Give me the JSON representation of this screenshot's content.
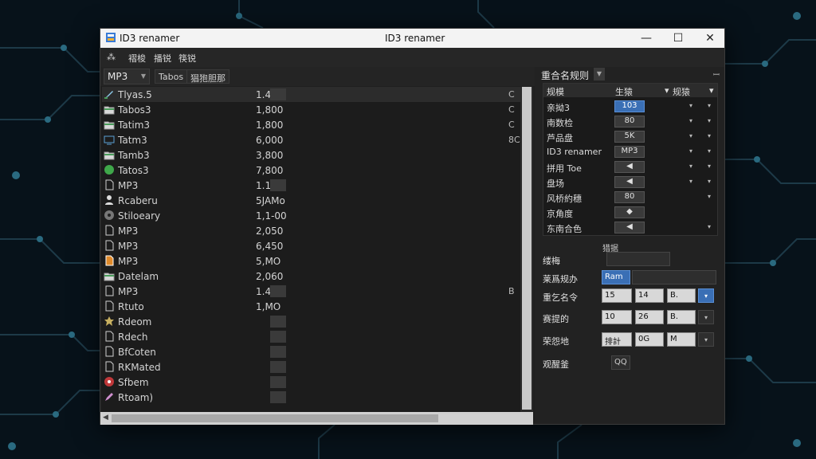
{
  "window": {
    "title_left": "ID3 renamer",
    "title_center": "ID3 renamer",
    "controls": {
      "minimize": "—",
      "maximize": "☐",
      "close": "✕"
    }
  },
  "menu": {
    "icon_glyph": "⁂",
    "items": [
      "褶梭",
      "播锐",
      "筷锐"
    ]
  },
  "toolbar": {
    "format_value": "MP3",
    "tab1": "Tabos",
    "tab2": "猖狍胆那"
  },
  "files": [
    {
      "name": "Tlyas.5",
      "size": "1.4",
      "extra": "C",
      "icon": "pen-icon",
      "selected": true
    },
    {
      "name": "Tabos3",
      "size": "1,800",
      "extra": "C",
      "icon": "folder-icon"
    },
    {
      "name": "Tatim3",
      "size": "1,800",
      "extra": "C",
      "icon": "folder-icon"
    },
    {
      "name": "Tatm3",
      "size": "6,000",
      "extra": "8C",
      "icon": "monitor-icon"
    },
    {
      "name": "Tamb3",
      "size": "3,800",
      "extra": "",
      "icon": "folder-icon"
    },
    {
      "name": "Tatos3",
      "size": "7,800",
      "extra": "",
      "icon": "green-circle-icon"
    },
    {
      "name": "MP3",
      "size": "1.1",
      "extra": "",
      "icon": "file-icon"
    },
    {
      "name": "Rcaberu",
      "size": "5JAMo",
      "extra": "",
      "icon": "person-icon"
    },
    {
      "name": "Stiloeary",
      "size": "1,1-00",
      "extra": "",
      "icon": "gear-icon"
    },
    {
      "name": "MP3",
      "size": "2,050",
      "extra": "",
      "icon": "file-icon"
    },
    {
      "name": "MP3",
      "size": "6,450",
      "extra": "",
      "icon": "file-icon"
    },
    {
      "name": "MP3",
      "size": "5,MO",
      "extra": "",
      "icon": "orange-file-icon"
    },
    {
      "name": "Datelam",
      "size": "2,060",
      "extra": "",
      "icon": "folder-icon"
    },
    {
      "name": "MP3",
      "size": "1.4",
      "extra": "B",
      "icon": "file-icon"
    },
    {
      "name": "Rtuto",
      "size": "1,MO",
      "extra": "",
      "icon": "file-icon"
    },
    {
      "name": "Rdeom",
      "size": "",
      "extra": "",
      "icon": "star-icon"
    },
    {
      "name": "Rdech",
      "size": "",
      "extra": "",
      "icon": "file-icon"
    },
    {
      "name": "BfCoten",
      "size": "",
      "extra": "",
      "icon": "file-icon"
    },
    {
      "name": "RKMated",
      "size": "",
      "extra": "",
      "icon": "file-icon"
    },
    {
      "name": "Sfbem",
      "size": "",
      "extra": "",
      "icon": "red-disc-icon"
    },
    {
      "name": "Rtoam)",
      "size": "",
      "extra": "",
      "icon": "pencil-icon"
    }
  ],
  "panel": {
    "header": "重合名规则",
    "pin": "ꟷ",
    "tag_headers": [
      "规模",
      "生猿",
      "规猿"
    ],
    "tags": [
      {
        "label": "亲拗3",
        "value": "103",
        "blue": true,
        "c1": "▾",
        "c2": "▾"
      },
      {
        "label": "南数检",
        "value": "80",
        "c1": "▾",
        "c2": "▾"
      },
      {
        "label": "芦品盘",
        "value": "5K",
        "c1": "▾",
        "c2": "▾"
      },
      {
        "label": "ID3 renamer",
        "value": "MP3",
        "c1": "▾",
        "c2": "▾"
      },
      {
        "label": "拼用 Toe",
        "value": "◀",
        "c1": "▾",
        "c2": "▾"
      },
      {
        "label": "盘场",
        "value": "◀",
        "c1": "▾",
        "c2": "▾"
      },
      {
        "label": "风桥約穗",
        "value": "80",
        "c1": "",
        "c2": "▾"
      },
      {
        "label": "京角度",
        "value": "◆",
        "c1": "",
        "c2": ""
      },
      {
        "label": "东南合色",
        "value": "◀",
        "c1": "",
        "c2": "▾"
      }
    ],
    "sub_label": "猎据",
    "forms": [
      {
        "label": "缕梅",
        "b1": "",
        "drop": ""
      },
      {
        "label": "莱爲规办",
        "b1": "Ram"
      },
      {
        "label": "重乞名令",
        "b1": "15",
        "b2": "14",
        "b3": "B.",
        "drop": "▾"
      },
      {
        "label": "赛提的",
        "b1": "10",
        "b2": "26",
        "b3": "B.",
        "drop": "▾"
      },
      {
        "label": "荣怨地",
        "b1": "排計",
        "b2": "0G",
        "b3": "M",
        "drop": "▾"
      },
      {
        "label": "观醒釜",
        "b1": "QQ"
      }
    ]
  }
}
